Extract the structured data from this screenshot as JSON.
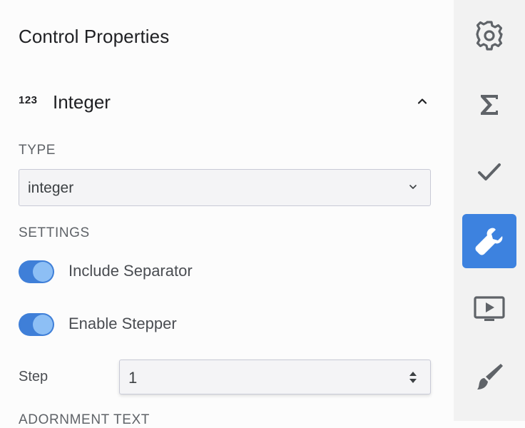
{
  "panel": {
    "title": "Control Properties"
  },
  "section": {
    "icon_text": "123",
    "label": "Integer",
    "collapse_icon": "chevron-up-icon"
  },
  "type_group": {
    "label": "TYPE",
    "select_value": "integer"
  },
  "settings_group": {
    "label": "SETTINGS",
    "toggles": [
      {
        "label": "Include Separator",
        "checked": true
      },
      {
        "label": "Enable Stepper",
        "checked": true
      }
    ],
    "step": {
      "label": "Step",
      "value": "1"
    }
  },
  "adornment_group": {
    "label": "ADORNMENT TEXT"
  },
  "right_rail": {
    "items": [
      {
        "icon": "gear-icon",
        "active": false
      },
      {
        "icon": "sigma-icon",
        "active": false
      },
      {
        "icon": "checkmark-icon",
        "active": false
      },
      {
        "icon": "wrench-icon",
        "active": true
      },
      {
        "icon": "slideshow-icon",
        "active": false
      },
      {
        "icon": "paintbrush-icon",
        "active": false
      }
    ]
  },
  "colors": {
    "accent": "#3d82df",
    "toggle_track": "#3f7fd8",
    "toggle_knob": "#8dbff5",
    "rail_background": "#f2f2f2",
    "muted_text": "#5f6368"
  }
}
